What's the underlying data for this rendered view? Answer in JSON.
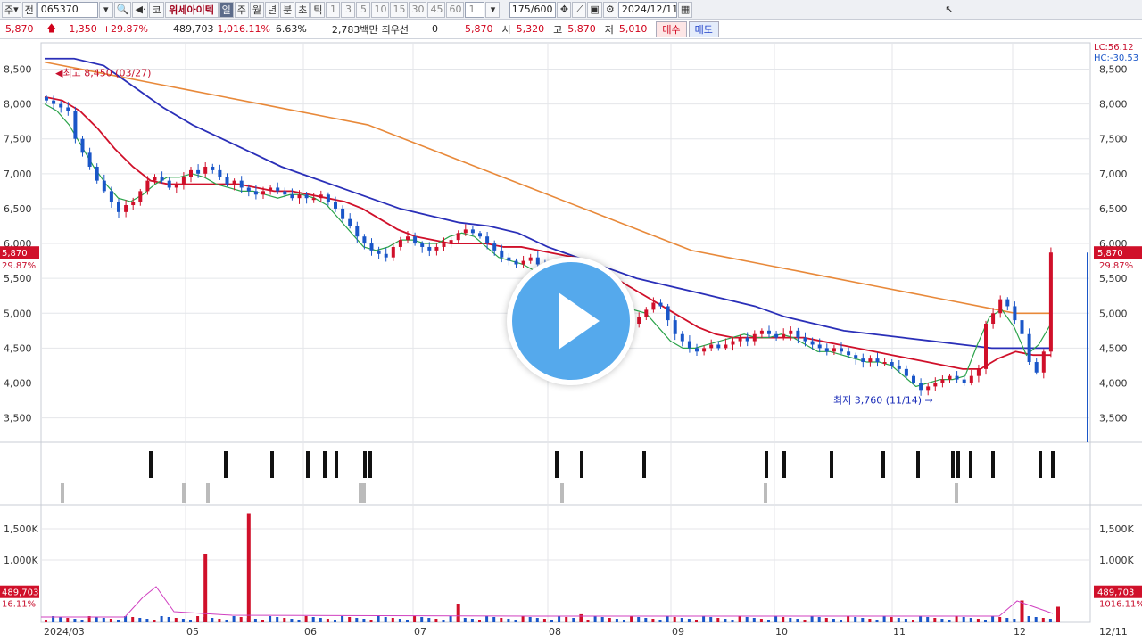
{
  "toolbar": {
    "market_label": "주",
    "type_label": "전",
    "code": "065370",
    "market_tag": "코",
    "stock_name": "위세아이텍",
    "periods": [
      "일",
      "주",
      "월",
      "년",
      "분",
      "초",
      "틱"
    ],
    "minutes": [
      "1",
      "3",
      "5",
      "10",
      "15",
      "30",
      "45",
      "60"
    ],
    "interval_value": "1",
    "count": "175",
    "count_total": "/600",
    "date": "2024/12/11"
  },
  "quote": {
    "price": "5,870",
    "change": "1,350",
    "change_pct": "+29.87%",
    "volume": "489,703",
    "volume_ratio": "1,016.11%",
    "turnover": "6.63%",
    "amount": "2,783백만",
    "best_label": "최우선",
    "best_val": "0",
    "best_price": "5,870",
    "open_label": "시",
    "open": "5,320",
    "high_label": "고",
    "high": "5,870",
    "low_label": "저",
    "low": "5,010",
    "buy": "매수",
    "sell": "매도"
  },
  "chart_data": {
    "type": "candlestick",
    "price_axis": {
      "ticks": [
        "8,500",
        "8,000",
        "7,500",
        "7,000",
        "6,500",
        "6,000",
        "5,500",
        "5,000",
        "4,500",
        "4,000",
        "3,500"
      ],
      "ylim": [
        3150,
        8800
      ]
    },
    "volume_axis": {
      "ticks": [
        "1,500K",
        "1,000K"
      ],
      "ylim": [
        0,
        1800000
      ]
    },
    "x_labels": [
      "2024/03",
      "05",
      "06",
      "07",
      "08",
      "09",
      "10",
      "11",
      "12",
      "12/11"
    ],
    "right_labels": {
      "lc": "LC:56.12",
      "hc": "HC:-30.53",
      "price": "5,870",
      "pct": "29.87%",
      "vol": "489,703",
      "vol_pct": "1016.11%"
    },
    "left_labels": {
      "price": "5,870",
      "pct": "29.87%",
      "vol": "489,703",
      "vol_pct": "16.11%"
    },
    "annotations": {
      "high": "최고 8,450 (03/27)",
      "low": "최저 3,760 (11/14)"
    },
    "close_series": [
      8050,
      8000,
      7950,
      7900,
      7500,
      7300,
      7100,
      6900,
      6750,
      6600,
      6450,
      6550,
      6600,
      6750,
      6900,
      6950,
      6900,
      6800,
      6850,
      6950,
      7050,
      7000,
      7100,
      7050,
      6950,
      6850,
      6900,
      6800,
      6750,
      6700,
      6750,
      6800,
      6750,
      6700,
      6650,
      6700,
      6650,
      6650,
      6700,
      6600,
      6500,
      6350,
      6250,
      6100,
      6000,
      5900,
      5850,
      5800,
      5950,
      6050,
      6100,
      6000,
      5950,
      5900,
      5950,
      6000,
      6050,
      6150,
      6200,
      6150,
      6100,
      6000,
      5900,
      5800,
      5750,
      5700,
      5750,
      5800,
      5700,
      5600,
      5500,
      5400,
      5350,
      5300,
      5200,
      5100,
      5000,
      4950,
      4900,
      4800,
      4700,
      4850,
      4950,
      5050,
      5150,
      5100,
      4900,
      4700,
      4600,
      4500,
      4450,
      4500,
      4550,
      4500,
      4550,
      4600,
      4650,
      4600,
      4700,
      4750,
      4700,
      4650,
      4700,
      4750,
      4650,
      4600,
      4550,
      4500,
      4450,
      4500,
      4450,
      4400,
      4350,
      4300,
      4350,
      4300,
      4300,
      4250,
      4200,
      4100,
      4000,
      3900,
      3950,
      4000,
      4050,
      4100,
      4050,
      4000,
      4100,
      4200,
      4850,
      5000,
      5200,
      5100,
      4900,
      4700,
      4300,
      4150,
      4450,
      5870
    ],
    "ma": {
      "ma5_green": [
        8000,
        7900,
        7700,
        7400,
        7100,
        6850,
        6650,
        6600,
        6700,
        6850,
        6950,
        6950,
        7000,
        6950,
        6850,
        6800,
        6750,
        6750,
        6700,
        6650,
        6700,
        6700,
        6650,
        6550,
        6350,
        6150,
        5950,
        5900,
        5950,
        6050,
        6050,
        6000,
        6000,
        6100,
        6150,
        6100,
        5950,
        5800,
        5750,
        5700,
        5600,
        5450,
        5300,
        5150,
        5000,
        4900,
        4850,
        4900,
        5050,
        5000,
        4800,
        4600,
        4500,
        4500,
        4550,
        4600,
        4650,
        4700,
        4650,
        4650,
        4700,
        4650,
        4550,
        4450,
        4450,
        4400,
        4350,
        4300,
        4300,
        4250,
        4100,
        3950,
        4000,
        4050,
        4050,
        4100,
        4550,
        4950,
        5050,
        4800,
        4400,
        4550,
        4850
      ],
      "ma20_red": [
        8100,
        8050,
        7900,
        7650,
        7350,
        7100,
        6900,
        6850,
        6850,
        6850,
        6850,
        6850,
        6800,
        6750,
        6750,
        6700,
        6650,
        6600,
        6500,
        6350,
        6200,
        6100,
        6050,
        6000,
        6000,
        6000,
        5950,
        5950,
        5900,
        5850,
        5800,
        5700,
        5550,
        5400,
        5250,
        5100,
        4950,
        4800,
        4700,
        4650,
        4650,
        4650,
        4650,
        4650,
        4600,
        4550,
        4500,
        4450,
        4400,
        4350,
        4300,
        4250,
        4200,
        4200,
        4350,
        4450,
        4400,
        4400
      ],
      "ma60_blue": [
        8650,
        8650,
        8550,
        8250,
        7950,
        7700,
        7500,
        7300,
        7100,
        6950,
        6800,
        6650,
        6500,
        6400,
        6300,
        6250,
        6150,
        5950,
        5800,
        5650,
        5500,
        5400,
        5300,
        5200,
        5100,
        4950,
        4850,
        4750,
        4700,
        4650,
        4600,
        4550,
        4500,
        4500,
        4500
      ],
      "ma120_orange": [
        8600,
        8500,
        8400,
        8300,
        8200,
        8100,
        8000,
        7900,
        7800,
        7700,
        7500,
        7300,
        7100,
        6900,
        6700,
        6500,
        6300,
        6100,
        5900,
        5800,
        5700,
        5600,
        5500,
        5400,
        5300,
        5200,
        5100,
        5000,
        5000
      ]
    },
    "volume_spikes": [
      {
        "date_index": 22,
        "value": 1100000
      },
      {
        "date_index": 28,
        "value": 1750000
      },
      {
        "date_index": 57,
        "value": 300000
      },
      {
        "date_index": 74,
        "value": 130000
      },
      {
        "date_index": 135,
        "value": 350000
      },
      {
        "date_index": 140,
        "value": 250000
      },
      {
        "date_index": 174,
        "value": 489703
      }
    ]
  }
}
